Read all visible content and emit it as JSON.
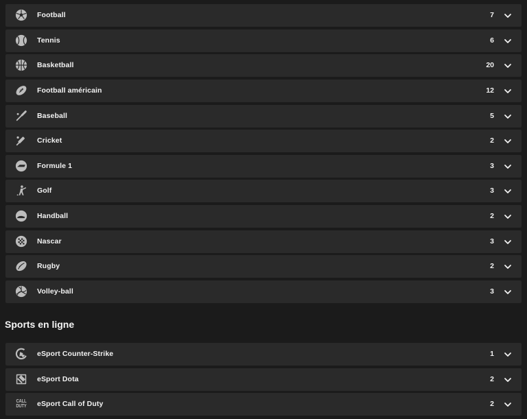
{
  "colors": {
    "background": "#1b1b1b",
    "row_background": "#2a2a2a",
    "text": "#f2f2f2",
    "icon": "#bdbdbd"
  },
  "sports": [
    {
      "label": "Football",
      "count": "7",
      "icon": "soccer-ball-icon"
    },
    {
      "label": "Tennis",
      "count": "6",
      "icon": "tennis-ball-icon"
    },
    {
      "label": "Basketball",
      "count": "20",
      "icon": "basketball-icon"
    },
    {
      "label": "Football américain",
      "count": "12",
      "icon": "american-football-icon"
    },
    {
      "label": "Baseball",
      "count": "5",
      "icon": "baseball-bat-icon"
    },
    {
      "label": "Cricket",
      "count": "2",
      "icon": "cricket-bat-icon"
    },
    {
      "label": "Formule 1",
      "count": "3",
      "icon": "formula1-car-icon"
    },
    {
      "label": "Golf",
      "count": "3",
      "icon": "golfer-icon"
    },
    {
      "label": "Handball",
      "count": "2",
      "icon": "handball-icon"
    },
    {
      "label": "Nascar",
      "count": "3",
      "icon": "checkered-flag-icon"
    },
    {
      "label": "Rugby",
      "count": "2",
      "icon": "rugby-ball-icon"
    },
    {
      "label": "Volley-ball",
      "count": "3",
      "icon": "volleyball-icon"
    }
  ],
  "online_section": {
    "title": "Sports en ligne",
    "items": [
      {
        "label": "eSport Counter-Strike",
        "count": "1",
        "icon": "counter-strike-icon"
      },
      {
        "label": "eSport Dota",
        "count": "2",
        "icon": "dota-icon"
      },
      {
        "label": "eSport Call of Duty",
        "count": "2",
        "icon": "call-of-duty-icon",
        "icon_text": [
          "CALL",
          "DUTY"
        ]
      }
    ]
  }
}
